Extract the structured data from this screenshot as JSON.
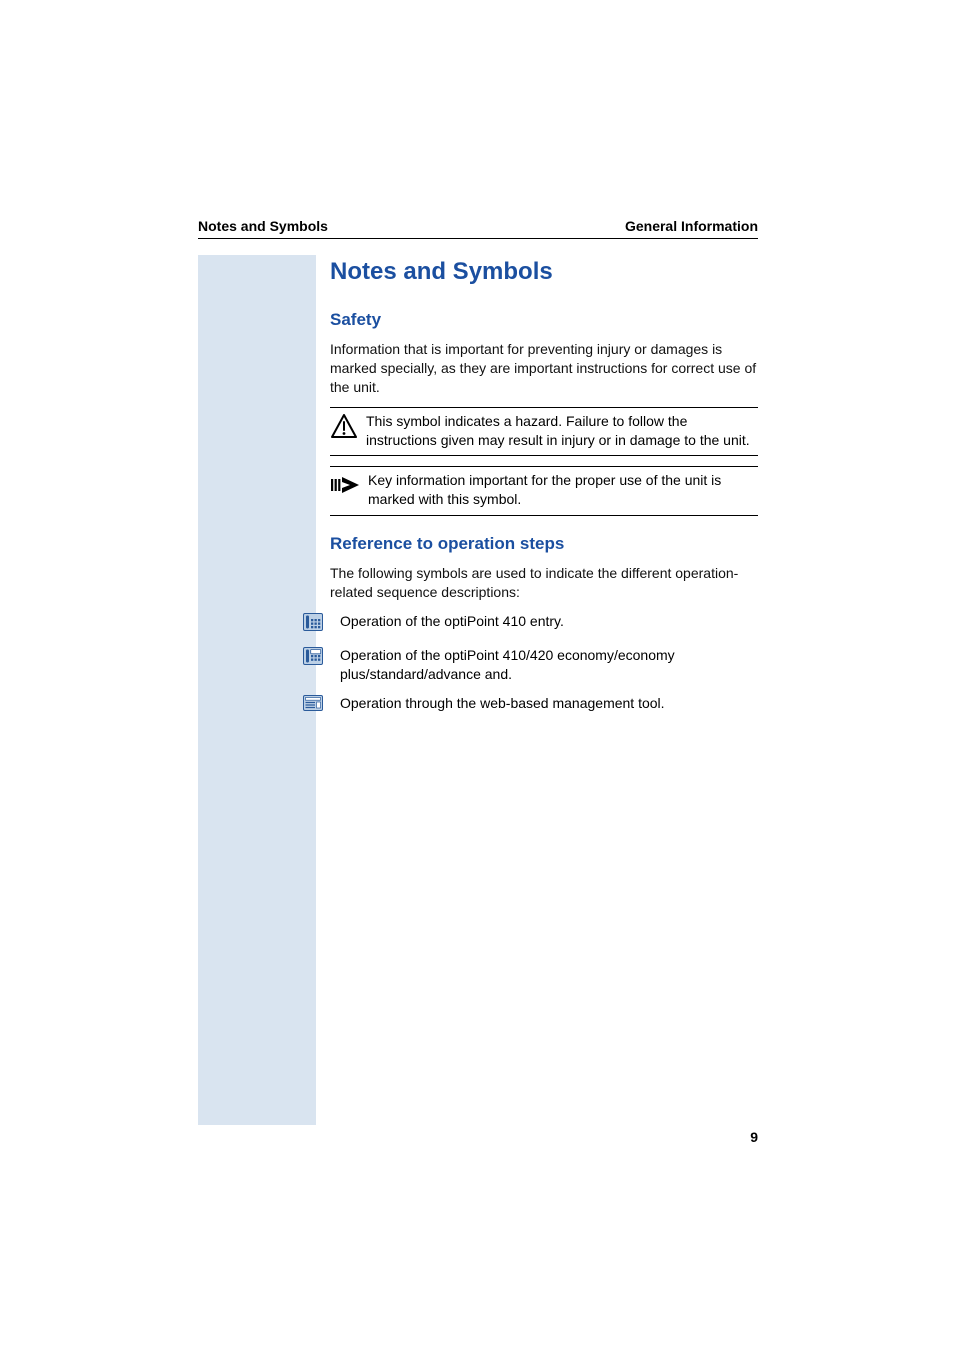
{
  "header": {
    "left": "Notes and Symbols",
    "right": "General Information"
  },
  "title": "Notes and Symbols",
  "sections": {
    "safety": {
      "heading": "Safety",
      "intro": "Information that is important for preventing injury or damages is marked specially, as they are important instructions for correct use of the unit.",
      "callouts": [
        {
          "icon": "hazard-icon",
          "text": "This symbol indicates a hazard. Failure to follow the instructions given may result in injury or in damage to the unit."
        },
        {
          "icon": "key-info-icon",
          "text": "Key information important for the proper use of the unit is marked with this symbol."
        }
      ]
    },
    "reference": {
      "heading": "Reference to operation steps",
      "intro": "The following symbols are used to indicate the different operation-related sequence descriptions:",
      "items": [
        {
          "icon": "phone-entry-icon",
          "text": "Operation of the optiPoint 410 entry."
        },
        {
          "icon": "phone-display-icon",
          "text": "Operation of the optiPoint 410/420 economy/economy plus/standard/advance and."
        },
        {
          "icon": "web-tool-icon",
          "text": "Operation through the web-based management tool."
        }
      ]
    }
  },
  "pageNumber": "9"
}
